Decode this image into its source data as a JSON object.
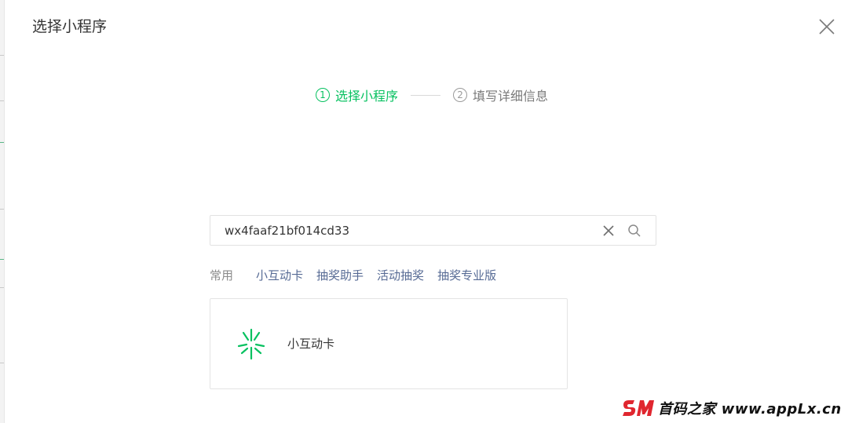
{
  "dialog": {
    "title": "选择小程序"
  },
  "steps": [
    {
      "number": "1",
      "label": "选择小程序",
      "state": "active"
    },
    {
      "number": "2",
      "label": "填写详细信息",
      "state": "pending"
    }
  ],
  "search": {
    "value": "wx4faaf21bf014cd33"
  },
  "quick_links": {
    "label": "常用",
    "items": [
      "小互动卡",
      "抽奖助手",
      "活动抽奖",
      "抽奖专业版"
    ]
  },
  "result": {
    "name": "小互动卡",
    "logo_icon": "sparkle-icon",
    "logo_color": "#07c160"
  },
  "watermark": {
    "text": "首码之家 www.appLx.cn"
  },
  "colors": {
    "accent": "#07c160",
    "link": "#576b95",
    "watermark_red": "#e0262f"
  }
}
